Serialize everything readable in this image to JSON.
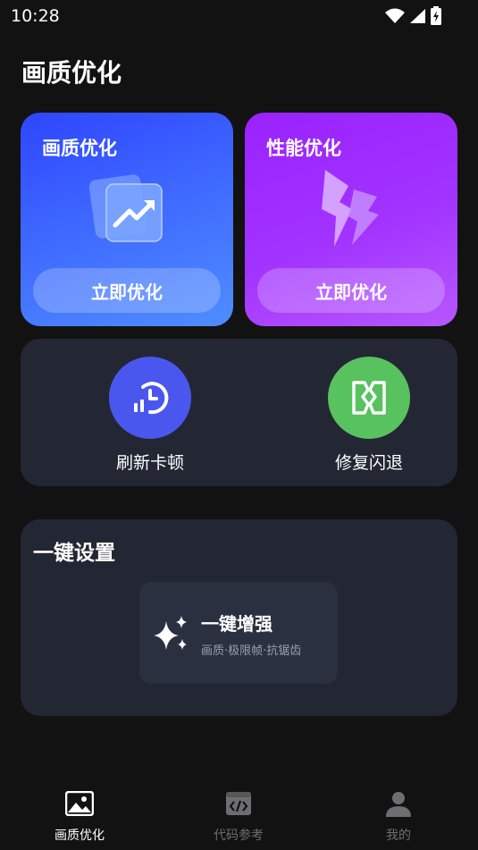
{
  "status": {
    "time": "10:28"
  },
  "page_title": "画质优化",
  "cards": {
    "quality": {
      "title": "画质优化",
      "button": "立即优化"
    },
    "performance": {
      "title": "性能优化",
      "button": "立即优化"
    }
  },
  "tools": {
    "refresh": {
      "label": "刷新卡顿"
    },
    "fix": {
      "label": "修复闪退"
    }
  },
  "settings": {
    "title": "一键设置",
    "enhance": {
      "title": "一键增强",
      "subtitle": "画质·极限帧·抗锯齿"
    }
  },
  "nav": {
    "home": "画质优化",
    "code": "代码参考",
    "me": "我的"
  },
  "colors": {
    "quality_card": "#3f6bff",
    "performance_card": "#a233ff",
    "refresh_circle": "#4a57ef",
    "fix_circle": "#58c25e",
    "panel": "#232734"
  }
}
